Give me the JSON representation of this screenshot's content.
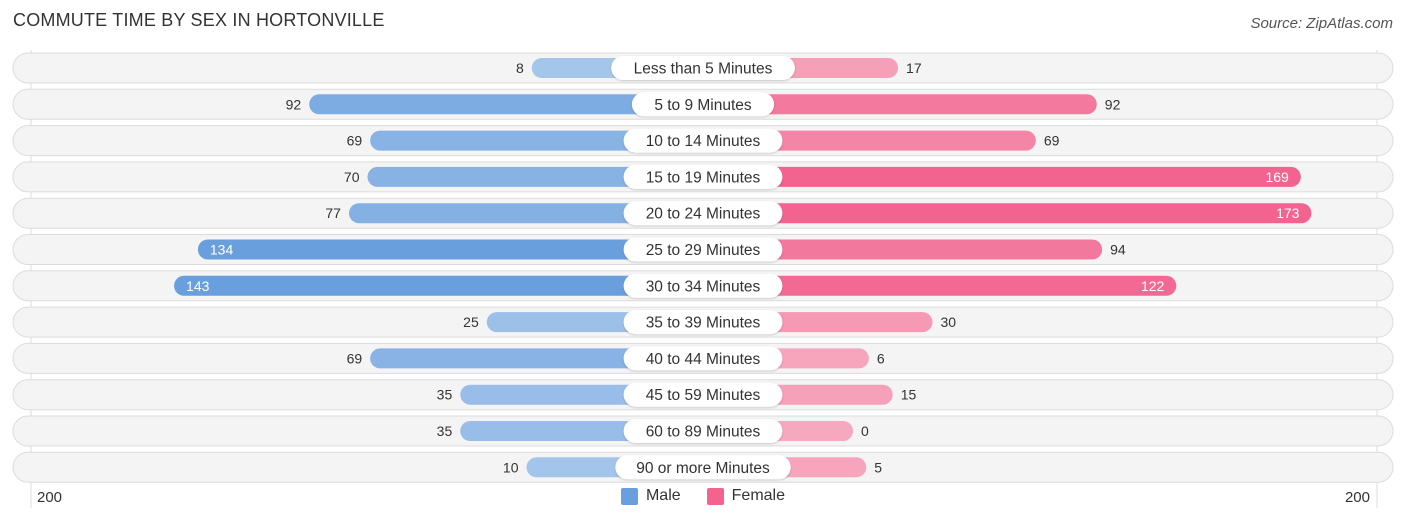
{
  "header": {
    "title": "COMMUTE TIME BY SEX IN HORTONVILLE",
    "source": "Source: ZipAtlas.com"
  },
  "axis": {
    "left_label": "200",
    "right_label": "200"
  },
  "legend": [
    {
      "name": "Male",
      "color": "#6a9fdd"
    },
    {
      "name": "Female",
      "color": "#f2648f"
    }
  ],
  "chart_data": {
    "type": "bar",
    "orientation": "horizontal-diverging",
    "title": "COMMUTE TIME BY SEX IN HORTONVILLE",
    "categories": [
      "Less than 5 Minutes",
      "5 to 9 Minutes",
      "10 to 14 Minutes",
      "15 to 19 Minutes",
      "20 to 24 Minutes",
      "25 to 29 Minutes",
      "30 to 34 Minutes",
      "35 to 39 Minutes",
      "40 to 44 Minutes",
      "45 to 59 Minutes",
      "60 to 89 Minutes",
      "90 or more Minutes"
    ],
    "series": [
      {
        "name": "Male",
        "values": [
          8,
          92,
          69,
          70,
          77,
          134,
          143,
          25,
          69,
          35,
          35,
          10
        ]
      },
      {
        "name": "Female",
        "values": [
          17,
          92,
          69,
          169,
          173,
          94,
          122,
          30,
          6,
          15,
          0,
          5
        ]
      }
    ],
    "xlim": [
      200,
      200
    ],
    "legend_position": "bottom-center"
  }
}
